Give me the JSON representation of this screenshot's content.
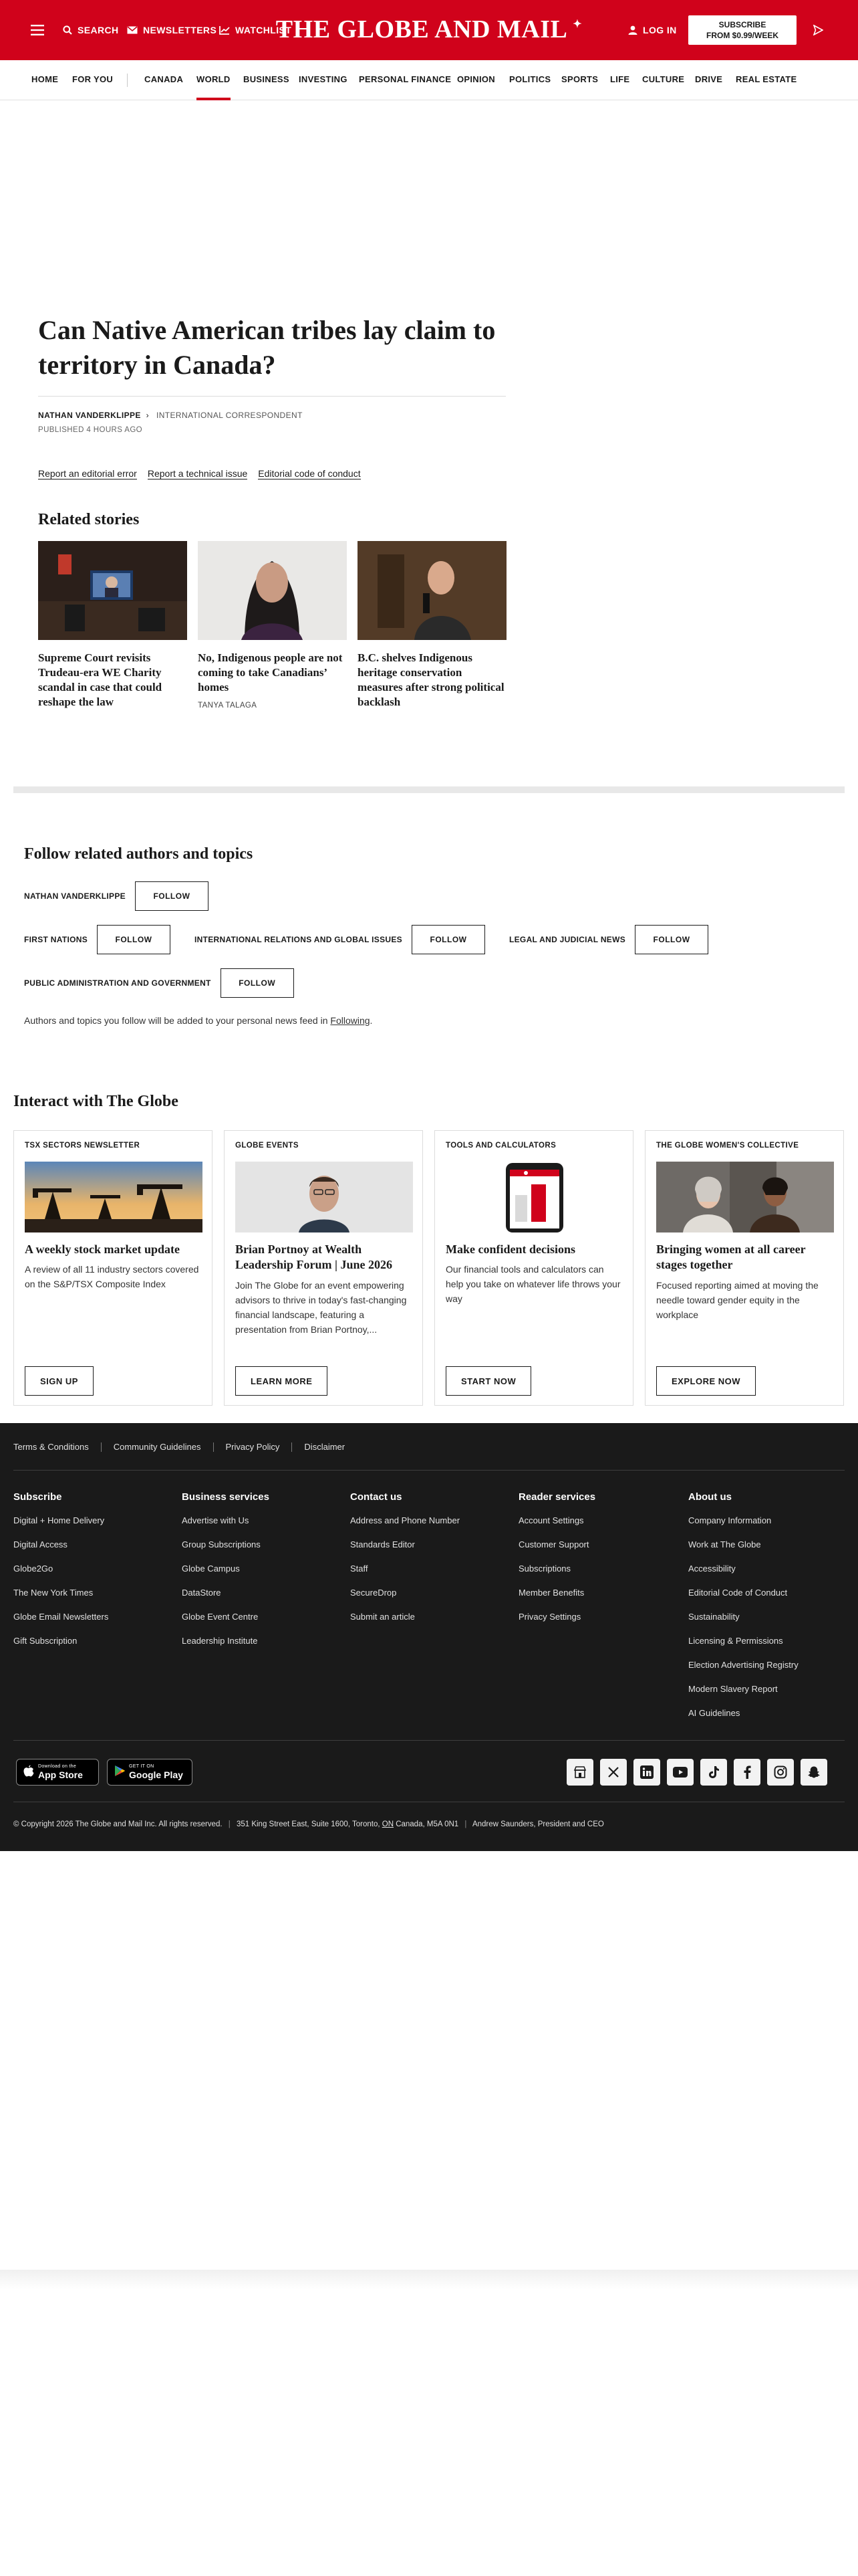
{
  "header": {
    "menu_icon": "hamburger-menu-icon",
    "search_label": "SEARCH",
    "newsletters_label": "NEWSLETTERS",
    "watchlist_label": "WATCHLIST",
    "brand": "THE GLOBE AND MAIL",
    "login_label": "LOG IN",
    "subscribe_line1": "SUBSCRIBE",
    "subscribe_line2": "FROM $0.99/WEEK",
    "accent_color": "#d0021b"
  },
  "nav": {
    "items": [
      "HOME",
      "FOR YOU",
      "CANADA",
      "WORLD",
      "BUSINESS",
      "INVESTING",
      "PERSONAL FINANCE",
      "OPINION",
      "POLITICS",
      "SPORTS",
      "LIFE",
      "CULTURE",
      "DRIVE",
      "REAL ESTATE"
    ],
    "active": "WORLD"
  },
  "article": {
    "headline": "Can Native American tribes lay claim to territory in Canada?",
    "author": "NATHAN VANDERKLIPPE",
    "author_role": "INTERNATIONAL CORRESPONDENT",
    "published": "PUBLISHED 4 HOURS AGO",
    "report_links": [
      "Report an editorial error",
      "Report a technical issue",
      "Editorial code of conduct"
    ]
  },
  "related": {
    "title": "Related stories",
    "stories": [
      {
        "title": "Supreme Court revisits Trudeau-era WE Charity scandal in case that could reshape the law",
        "author": ""
      },
      {
        "title": "No, Indigenous people are not coming to take Canadians’ homes",
        "author": "TANYA TALAGA"
      },
      {
        "title": "B.C. shelves Indigenous heritage conservation measures after strong political backlash",
        "author": ""
      }
    ]
  },
  "follow": {
    "title": "Follow related authors and topics",
    "button_label": "FOLLOW",
    "tags": [
      "NATHAN VANDERKLIPPE",
      "FIRST NATIONS",
      "INTERNATIONAL RELATIONS AND GLOBAL ISSUES",
      "LEGAL AND JUDICIAL NEWS",
      "PUBLIC ADMINISTRATION AND GOVERNMENT"
    ],
    "note_prefix": "Authors and topics you follow will be added to your personal news feed in ",
    "note_link": "Following",
    "note_suffix": "."
  },
  "interact": {
    "title": "Interact with The Globe",
    "cards": [
      {
        "eyebrow": "TSX SECTORS NEWSLETTER",
        "title": "A weekly stock market update",
        "desc": "A review of all 11 industry sectors covered on the S&P/TSX Composite Index",
        "button": "SIGN UP"
      },
      {
        "eyebrow": "GLOBE EVENTS",
        "title": "Brian Portnoy at Wealth Leadership Forum | June 2026",
        "desc": "Join The Globe for an event empowering advisors to thrive in today's fast-changing financial landscape, featuring a presentation from Brian Portnoy,...",
        "button": "LEARN MORE"
      },
      {
        "eyebrow": "TOOLS AND CALCULATORS",
        "title": "Make confident decisions",
        "desc": "Our financial tools and calculators can help you take on whatever life throws your way",
        "button": "START NOW"
      },
      {
        "eyebrow": "THE GLOBE WOMEN'S COLLECTIVE",
        "title": "Bringing women at all career stages together",
        "desc": "Focused reporting aimed at moving the needle toward gender equity in the workplace",
        "button": "EXPLORE NOW"
      }
    ]
  },
  "footer": {
    "legal": [
      "Terms & Conditions",
      "Community Guidelines",
      "Privacy Policy",
      "Disclaimer"
    ],
    "columns": [
      {
        "heading": "Subscribe",
        "links": [
          "Digital + Home Delivery",
          "Digital Access",
          "Globe2Go",
          "The New York Times",
          "Globe Email Newsletters",
          "Gift Subscription"
        ]
      },
      {
        "heading": "Business services",
        "links": [
          "Advertise with Us",
          "Group Subscriptions",
          "Globe Campus",
          "DataStore",
          "Globe Event Centre",
          "Leadership Institute"
        ]
      },
      {
        "heading": "Contact us",
        "links": [
          "Address and Phone Number",
          "Standards Editor",
          "Staff",
          "SecureDrop",
          "Submit an article"
        ]
      },
      {
        "heading": "Reader services",
        "links": [
          "Account Settings",
          "Customer Support",
          "Subscriptions",
          "Member Benefits",
          "Privacy Settings"
        ]
      },
      {
        "heading": "About us",
        "links": [
          "Company Information",
          "Work at The Globe",
          "Accessibility",
          "Editorial Code of Conduct",
          "Sustainability",
          "Licensing & Permissions",
          "Election Advertising Registry",
          "Modern Slavery Report",
          "AI Guidelines"
        ]
      }
    ],
    "app_store_small": "Download on the",
    "app_store_big": "App Store",
    "google_play_small": "GET IT ON",
    "google_play_big": "Google Play",
    "social_icons": [
      "store-icon",
      "x-icon",
      "linkedin-icon",
      "youtube-icon",
      "tiktok-icon",
      "facebook-icon",
      "instagram-icon",
      "snapchat-icon"
    ],
    "copyright_prefix": "© Copyright 2026 The Globe and Mail Inc. All rights reserved.",
    "address_prefix": "351 King Street East, Suite 1600, Toronto, ",
    "address_province": "ON",
    "address_suffix": " Canada, M5A 0N1",
    "ceo": "Andrew Saunders, President and CEO"
  }
}
